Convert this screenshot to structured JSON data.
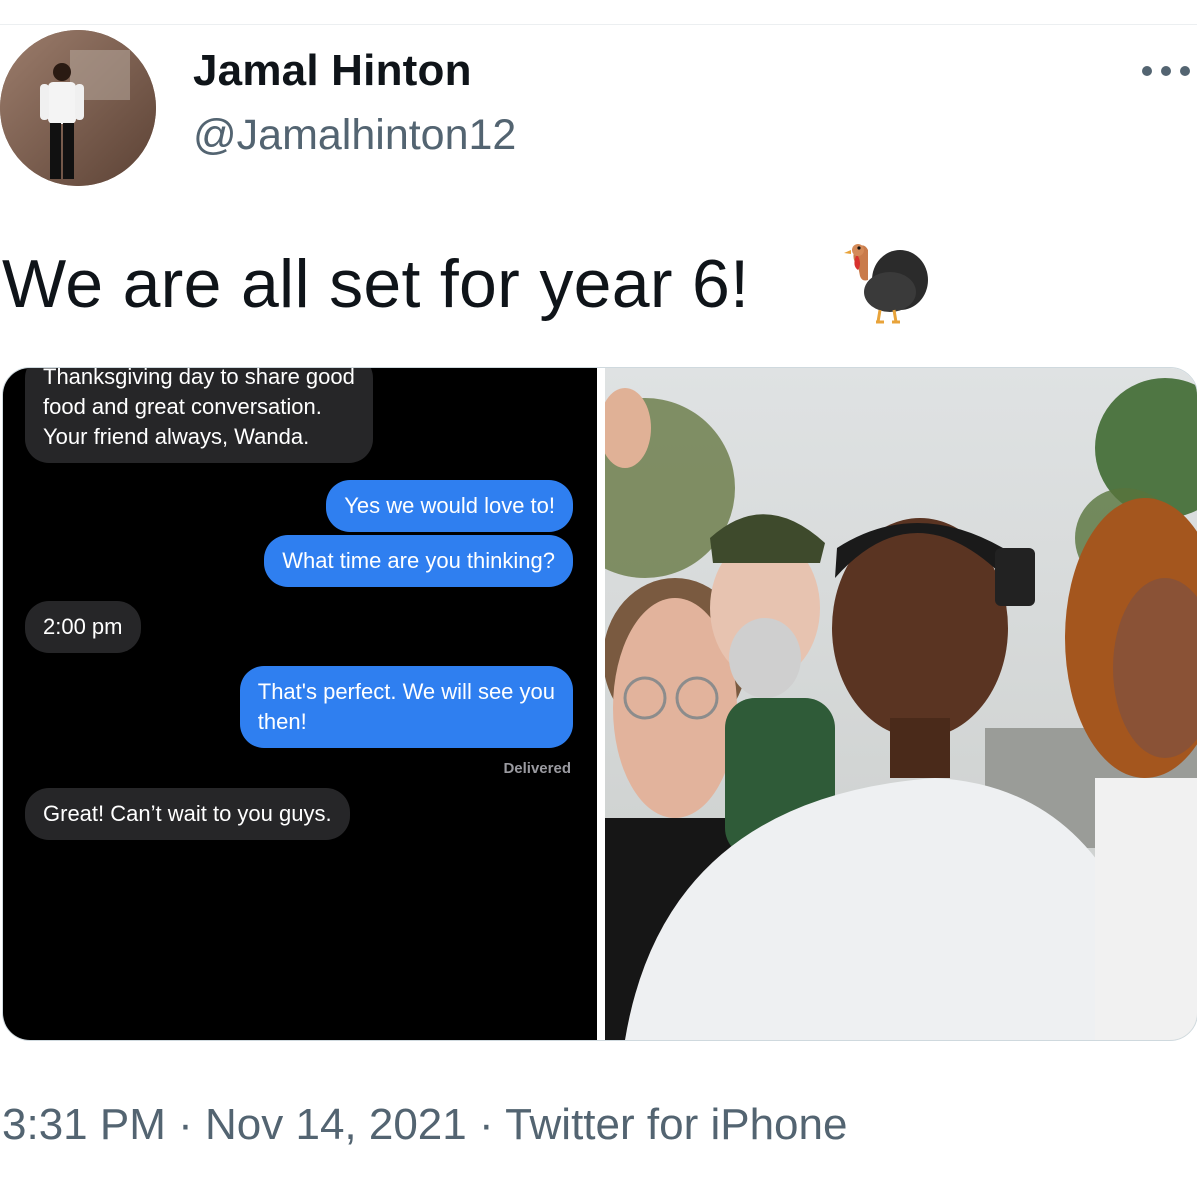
{
  "tweet": {
    "author_name": "Jamal Hinton",
    "author_handle": "@Jamalhinton12",
    "text": "We are all set for year 6!",
    "emoji": "turkey-emoji",
    "more_icon": "more-options-icon"
  },
  "chat": {
    "messages": [
      {
        "from": "them",
        "lines": [
          "Thanksgiving day to share good",
          "food and great conversation.",
          "Your friend always, Wanda."
        ]
      },
      {
        "from": "me",
        "lines": [
          "Yes we would love to!"
        ]
      },
      {
        "from": "me",
        "lines": [
          "What time are you thinking?"
        ]
      },
      {
        "from": "them",
        "lines": [
          "2:00 pm"
        ]
      },
      {
        "from": "me",
        "lines": [
          "That's perfect. We will see you",
          "then!"
        ]
      },
      {
        "from": "them",
        "lines": [
          "Great! Can’t wait to you guys."
        ]
      }
    ],
    "delivered_label": "Delivered"
  },
  "footer": {
    "time": "3:31 PM",
    "date": "Nov 14, 2021",
    "source": "Twitter for iPhone",
    "separator": "·"
  },
  "colors": {
    "imessage_blue": "#2f7ff0",
    "received_gray": "#262628",
    "secondary_text": "#536471"
  }
}
